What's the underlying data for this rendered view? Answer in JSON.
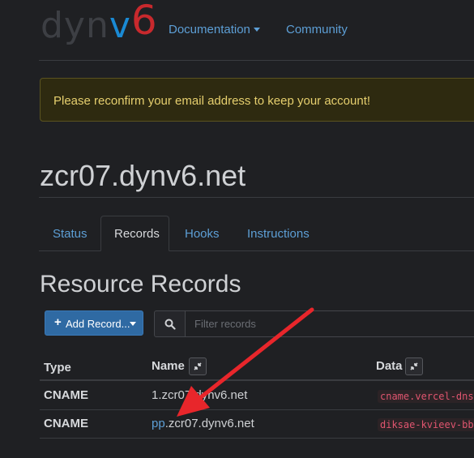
{
  "brand": {
    "part1": "dyn",
    "part2": "v",
    "part3": "6"
  },
  "nav": {
    "documentation": "Documentation",
    "community": "Community"
  },
  "alert": {
    "message": "Please reconfirm your email address to keep your account!"
  },
  "page": {
    "title": "zcr07.dynv6.net"
  },
  "tabs": [
    {
      "label": "Status"
    },
    {
      "label": "Records",
      "active": true
    },
    {
      "label": "Hooks"
    },
    {
      "label": "Instructions"
    }
  ],
  "section": {
    "title": "Resource Records"
  },
  "toolbar": {
    "add_label": "Add Record...",
    "filter_placeholder": "Filter records"
  },
  "table": {
    "headers": {
      "type": "Type",
      "name": "Name",
      "data": "Data"
    },
    "rows": [
      {
        "type": "CNAME",
        "name_prefix": "",
        "name_suffix": "1.zcr07.dynv6.net",
        "data": "cname.vercel-dns"
      },
      {
        "type": "CNAME",
        "name_prefix": "pp",
        "name_suffix": ".zcr07.dynv6.net",
        "data": "diksae-kvieev-bb"
      }
    ]
  },
  "colors": {
    "accent": "#5d9fd6",
    "logo_red": "#c8292d",
    "alert_text": "#e6cf6e",
    "code": "#e0556f",
    "annotation_arrow": "#e8262b"
  },
  "icons": {
    "compress": "compress-icon",
    "search": "search-icon",
    "plus": "plus-icon"
  }
}
